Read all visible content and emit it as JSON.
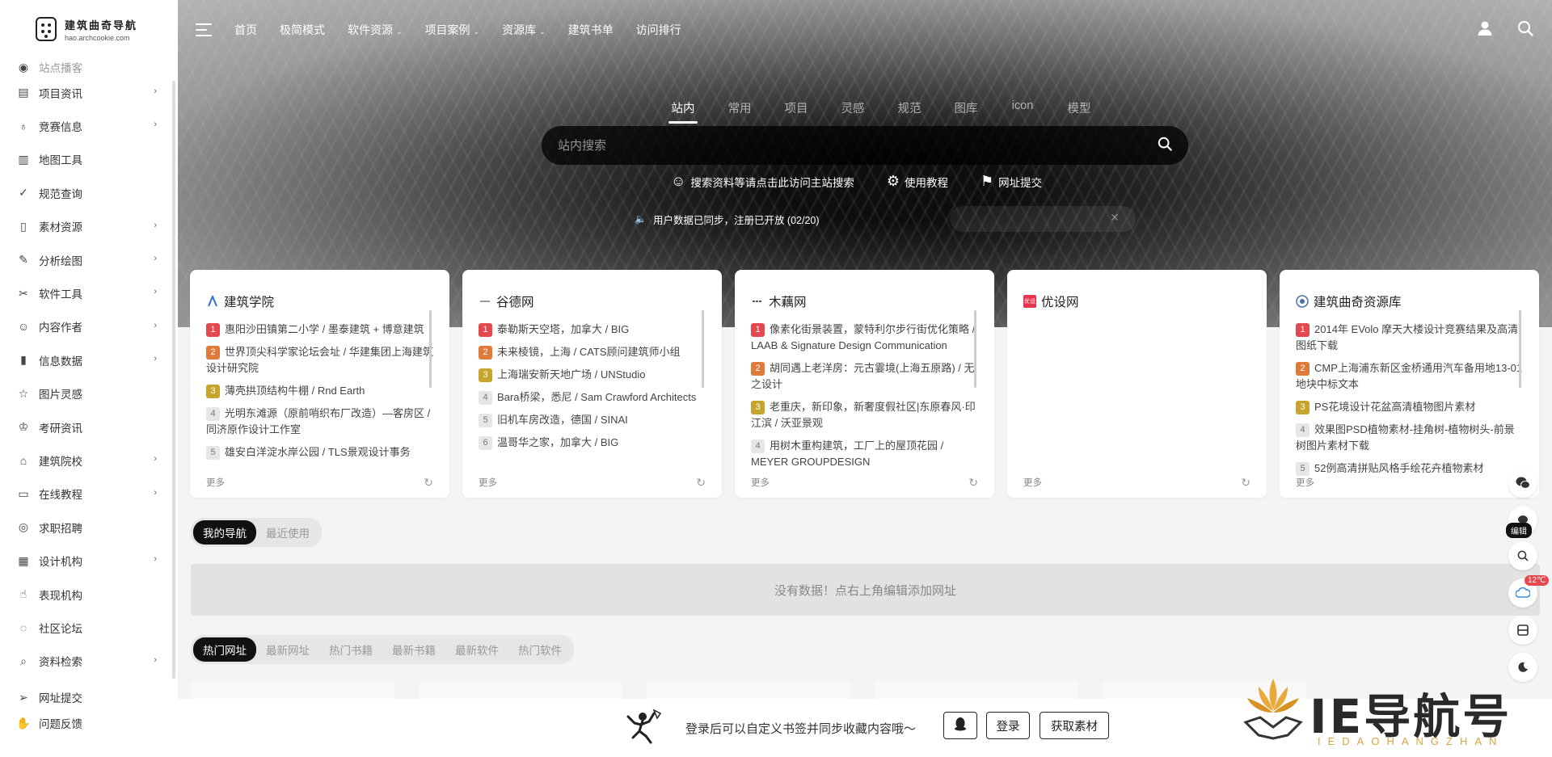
{
  "brand": {
    "name": "建筑曲奇导航",
    "domain": "hao.archcookie.com"
  },
  "sidebar": {
    "items": [
      {
        "label": "站点播客",
        "icon": "podcast-icon",
        "chevron": false,
        "cut": true
      },
      {
        "label": "项目资讯",
        "icon": "newspaper-icon",
        "chevron": true
      },
      {
        "label": "竞赛信息",
        "icon": "award-icon",
        "chevron": true
      },
      {
        "label": "地图工具",
        "icon": "map-icon",
        "chevron": false
      },
      {
        "label": "规范查询",
        "icon": "check-circle-icon",
        "chevron": false
      },
      {
        "label": "素材资源",
        "icon": "file-icon",
        "chevron": true
      },
      {
        "label": "分析绘图",
        "icon": "brush-icon",
        "chevron": true
      },
      {
        "label": "软件工具",
        "icon": "tools-icon",
        "chevron": true
      },
      {
        "label": "内容作者",
        "icon": "user-icon",
        "chevron": true
      },
      {
        "label": "信息数据",
        "icon": "bar-chart-icon",
        "chevron": true
      },
      {
        "label": "图片灵感",
        "icon": "star-icon",
        "chevron": false
      },
      {
        "label": "考研资讯",
        "icon": "graduate-icon",
        "chevron": false
      },
      {
        "label": "建筑院校",
        "icon": "university-icon",
        "chevron": true
      },
      {
        "label": "在线教程",
        "icon": "monitor-icon",
        "chevron": true
      },
      {
        "label": "求职招聘",
        "icon": "id-card-icon",
        "chevron": false
      },
      {
        "label": "设计机构",
        "icon": "building-icon",
        "chevron": true
      },
      {
        "label": "表现机构",
        "icon": "thumbs-up-icon",
        "chevron": false
      },
      {
        "label": "社区论坛",
        "icon": "chat-icon",
        "chevron": false
      },
      {
        "label": "资料检索",
        "icon": "search-icon",
        "chevron": true
      }
    ],
    "bottom_items": [
      {
        "label": "网址提交",
        "icon": "send-icon"
      },
      {
        "label": "问题反馈",
        "icon": "hand-icon"
      }
    ]
  },
  "topnav": {
    "items": [
      {
        "label": "首页",
        "dropdown": false
      },
      {
        "label": "极简模式",
        "dropdown": false
      },
      {
        "label": "软件资源",
        "dropdown": true
      },
      {
        "label": "项目案例",
        "dropdown": true
      },
      {
        "label": "资源库",
        "dropdown": true
      },
      {
        "label": "建筑书单",
        "dropdown": false
      },
      {
        "label": "访问排行",
        "dropdown": false
      }
    ],
    "right_icons": [
      "user-icon",
      "search-icon"
    ]
  },
  "search": {
    "tabs": [
      "站内",
      "常用",
      "项目",
      "灵感",
      "规范",
      "图库",
      "icon",
      "模型"
    ],
    "active_tab": 0,
    "placeholder": "站内搜索",
    "quick_links": [
      {
        "label": "搜索资料等请点击此访问主站搜索",
        "icon": "smile-icon"
      },
      {
        "label": "使用教程",
        "icon": "gear-icon"
      },
      {
        "label": "网址提交",
        "icon": "bookmark-icon"
      }
    ],
    "notice": "用户数据已同步，注册已开放 (02/20)"
  },
  "cards": [
    {
      "title": "建筑学院",
      "logo": "archcollege-logo",
      "items": [
        "惠阳沙田镇第二小学 / 墨泰建筑 + 博意建筑",
        "世界顶尖科学家论坛会址 / 华建集团上海建筑设计研究院",
        "薄壳拱顶结构牛棚 / Rnd Earth",
        "光明东滩源（原前哨织布厂改造）—客房区 / 同济原作设计工作室",
        "雄安白洋淀水岸公园 / TLS景观设计事务"
      ],
      "more": "更多"
    },
    {
      "title": "谷德网",
      "logo": "gooood-logo",
      "items": [
        "泰勒斯天空塔，加拿大 / BIG",
        "未来棱镜，上海 / CATS顾问建筑师小组",
        "上海瑞安新天地广场 / UNStudio",
        "Bara桥梁，悉尼 / Sam Crawford Architects",
        "旧机车房改造，德国 / SINAI",
        "温哥华之家，加拿大 / BIG"
      ],
      "more": "更多"
    },
    {
      "title": "木藕网",
      "logo": "mooool-logo",
      "items": [
        "像素化街景装置，蒙特利尔步行街优化策略 / LAAB & Signature Design Communication",
        "胡同遇上老洋房：元古霎境(上海五原路) / 无之设计",
        "老重庆，新印象，新奢度假社区|东原春风·印江滨 / 沃亚景观",
        "用树木重构建筑，工厂上的屋顶花园 / MEYER GROUPDESIGN"
      ],
      "more": "更多"
    },
    {
      "title": "优设网",
      "logo": "uisdc-logo",
      "logo_text": "优设",
      "items": [],
      "more": "更多"
    },
    {
      "title": "建筑曲奇资源库",
      "logo": "archcookie-logo",
      "items": [
        "2014年 EVolo 摩天大楼设计竞赛结果及高清图纸下载",
        "CMP上海浦东新区金桥通用汽车备用地13-01地块中标文本",
        "PS花境设计花盆高清植物图片素材",
        "效果图PSD植物素材-挂角树-植物树头-前景树图片素材下载",
        "52例高清拼贴风格手绘花卉植物素材"
      ],
      "more": "更多"
    }
  ],
  "my_nav": {
    "tabs": [
      "我的导航",
      "最近使用"
    ],
    "active": 0,
    "empty_text": "没有数据！点右上角编辑添加网址"
  },
  "hot_nav": {
    "tabs": [
      "热门网址",
      "最新网址",
      "热门书籍",
      "最新书籍",
      "最新软件",
      "热门软件"
    ],
    "active": 0
  },
  "bottom_bar": {
    "text": "登录后可以自定义书签并同步收藏内容哦～",
    "buttons": [
      "登录",
      "获取素材"
    ]
  },
  "float_bar": {
    "edit_label": "编辑",
    "temperature": "12℃"
  },
  "watermark": {
    "main": "IE导航号",
    "sub": "IEDAOHANGZHAN"
  },
  "colors": {
    "rank1": "#e5484d",
    "rank2": "#e07a3a",
    "rank3": "#c7a52c",
    "active_pill": "#111111",
    "watermark_gold": "#d9a441"
  }
}
